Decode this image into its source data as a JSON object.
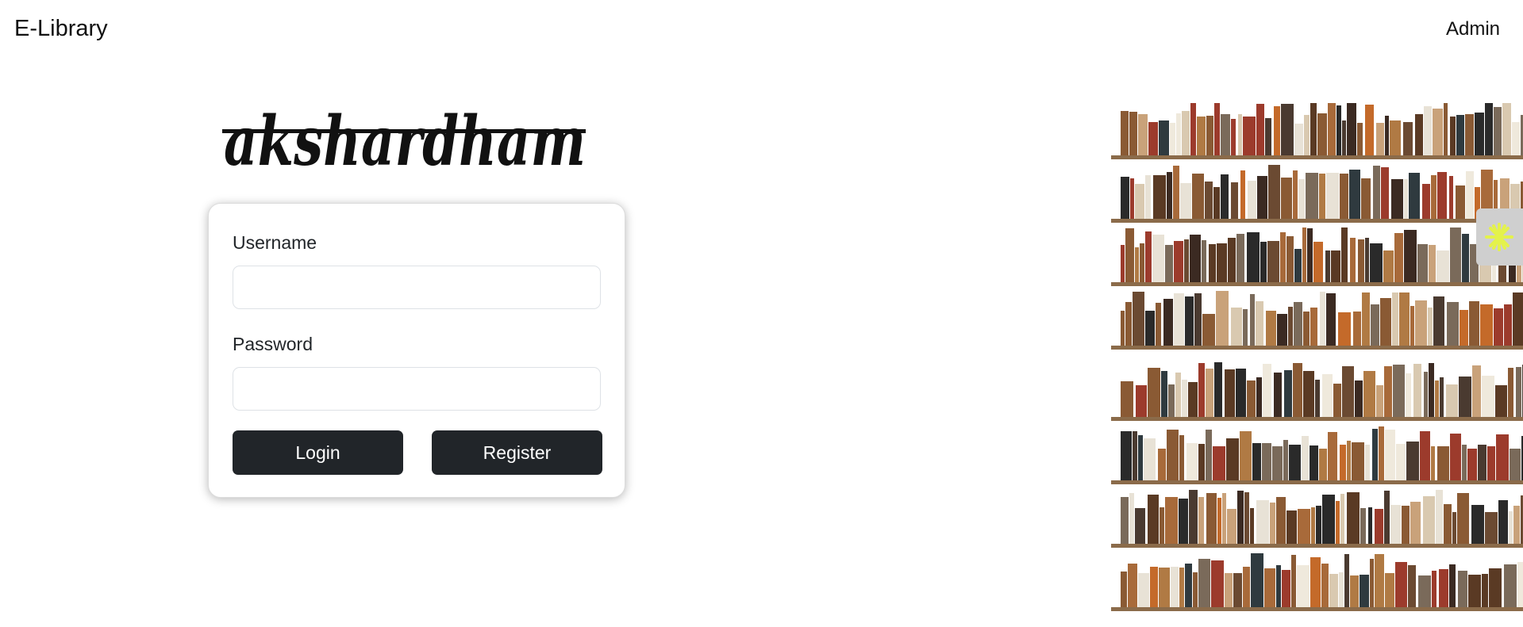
{
  "navbar": {
    "brand": "E-Library",
    "admin_link": "Admin"
  },
  "logo": {
    "text": "akshardham"
  },
  "login_form": {
    "username_label": "Username",
    "username_value": "",
    "password_label": "Password",
    "password_value": "",
    "login_label": "Login",
    "register_label": "Register"
  },
  "decor": {
    "bookshelf_image": "bookshelf-illustration",
    "side_widget_icon": "asterisk-icon"
  },
  "colors": {
    "button_bg": "#212529",
    "button_text": "#ffffff",
    "widget_accent": "#e4f24b",
    "shelf_wood": "#8b6b4a"
  }
}
